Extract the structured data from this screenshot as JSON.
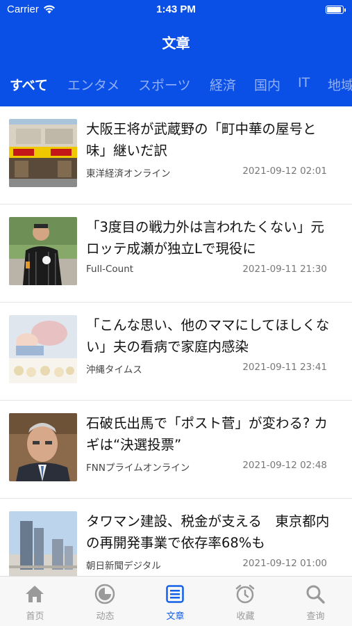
{
  "status_bar": {
    "carrier": "Carrier",
    "time": "1:43 PM",
    "battery_level": 1.0
  },
  "header": {
    "title": "文章"
  },
  "tabs": [
    {
      "label": "すべて",
      "active": true
    },
    {
      "label": "エンタメ",
      "active": false
    },
    {
      "label": "スポーツ",
      "active": false
    },
    {
      "label": "経済",
      "active": false
    },
    {
      "label": "国内",
      "active": false
    },
    {
      "label": "IT",
      "active": false
    },
    {
      "label": "地域",
      "active": false
    }
  ],
  "articles": [
    {
      "headline": "大阪王将が武蔵野の「町中華の屋号と味」継いだ訳",
      "source": "東洋経済オンライン",
      "date": "2021-09-12 02:01"
    },
    {
      "headline": "「3度目の戦力外は言われたくない」元ロッテ成瀬が独立Lで現役に",
      "source": "Full-Count",
      "date": "2021-09-11 21:30"
    },
    {
      "headline": "「こんな思い、他のママにしてほしくない」夫の看病で家庭内感染",
      "source": "沖縄タイムス",
      "date": "2021-09-11 23:41"
    },
    {
      "headline": "石破氏出馬で「ポスト菅」が変わる? カギは“決選投票”",
      "source": "FNNプライムオンライン",
      "date": "2021-09-12 02:48"
    },
    {
      "headline": "タワマン建設、税金が支える　東京都内の再開発事業で依存率68%も",
      "source": "朝日新聞デジタル",
      "date": "2021-09-12 01:00"
    }
  ],
  "tabbar": [
    {
      "label": "首页",
      "icon": "home-icon",
      "active": false
    },
    {
      "label": "动态",
      "icon": "activity-icon",
      "active": false
    },
    {
      "label": "文章",
      "icon": "article-icon",
      "active": true
    },
    {
      "label": "收藏",
      "icon": "alarm-clock-icon",
      "active": false
    },
    {
      "label": "查询",
      "icon": "search-icon",
      "active": false
    }
  ],
  "colors": {
    "accent": "#0a4fe6",
    "tab_active": "#1460e8",
    "tab_inactive": "#9a9a9a"
  }
}
